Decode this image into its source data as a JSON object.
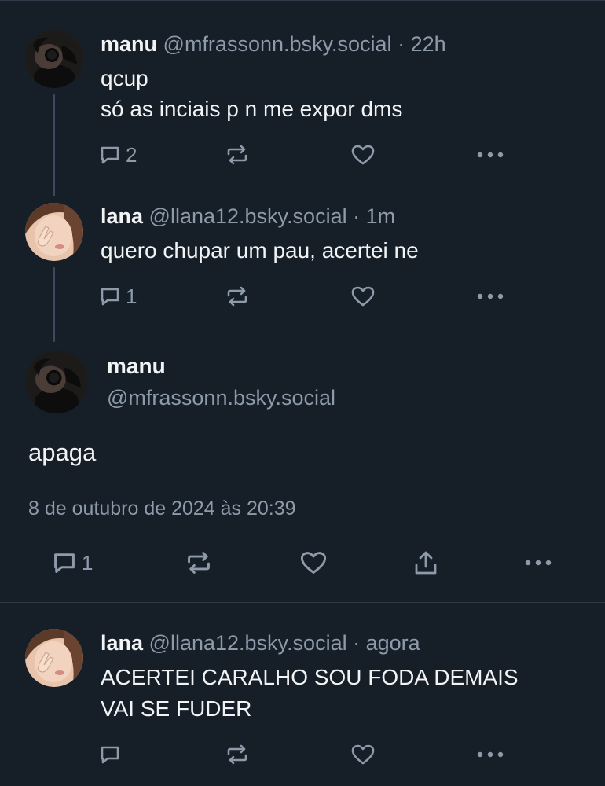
{
  "posts": [
    {
      "name": "manu",
      "handle": "@mfrassonn.bsky.social",
      "separator": "·",
      "time": "22h",
      "lines": [
        "qcup",
        "só as inciais p n me expor dms"
      ],
      "reply_count": "2"
    },
    {
      "name": "lana",
      "handle": "@llana12.bsky.social",
      "separator": "·",
      "time": "1m",
      "lines": [
        "quero chupar um pau, acertei ne"
      ],
      "reply_count": "1"
    }
  ],
  "focus": {
    "name": "manu",
    "handle": "@mfrassonn.bsky.social",
    "text": "apaga",
    "date": "8 de outubro de 2024 às 20:39",
    "reply_count": "1"
  },
  "reply": {
    "name": "lana",
    "handle": "@llana12.bsky.social",
    "separator": "·",
    "time": "agora",
    "lines": [
      "ACERTEI CARALHO SOU FODA DEMAIS",
      "VAI SE FUDER"
    ]
  },
  "icons": {
    "reply": "reply-icon",
    "repost": "repost-icon",
    "like": "heart-icon",
    "share": "share-icon",
    "more": "more-icon"
  },
  "colors": {
    "background": "#161e27",
    "text": "#f1f3f5",
    "muted": "#8c9aaa",
    "thread_line": "#3b4a5a"
  }
}
